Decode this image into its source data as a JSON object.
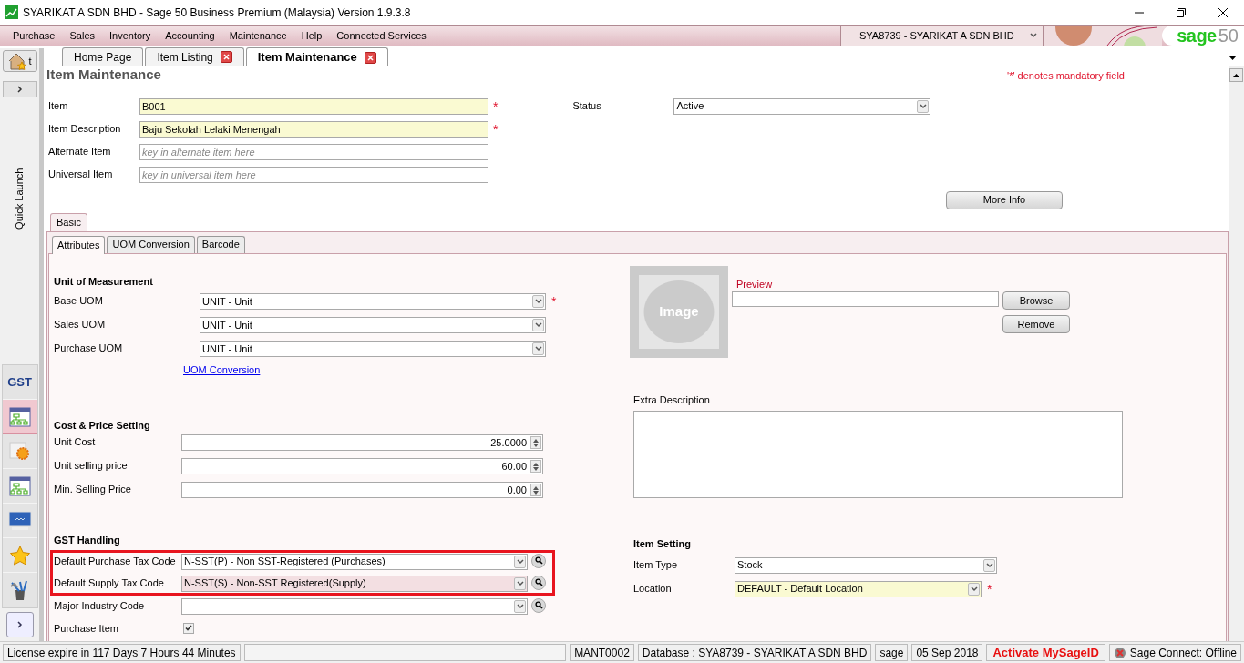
{
  "window": {
    "title": "SYARIKAT A SDN BHD - Sage 50 Business Premium (Malaysia) Version 1.9.3.8"
  },
  "menu": [
    "Purchase",
    "Sales",
    "Inventory",
    "Accounting",
    "Maintenance",
    "Help",
    "Connected Services"
  ],
  "company_selector": {
    "value": "SYA8739 - SYARIKAT A SDN BHD"
  },
  "logo": {
    "brand": "sage",
    "number": "50"
  },
  "sidebar": {
    "home_label": "t",
    "quick_launch": "Quick Launch",
    "items": [
      {
        "kind": "gst",
        "label": "GST",
        "selected": false
      },
      {
        "kind": "tree",
        "selected": true
      },
      {
        "kind": "sun",
        "selected": false
      },
      {
        "kind": "tree",
        "selected": false
      },
      {
        "kind": "monitor",
        "selected": false
      },
      {
        "kind": "star",
        "selected": false
      },
      {
        "kind": "tools",
        "selected": false
      }
    ]
  },
  "tabs": [
    {
      "label": "Home Page",
      "selected": false,
      "closable": false
    },
    {
      "label": "Item Listing",
      "selected": false,
      "closable": true
    },
    {
      "label": "Item Maintenance",
      "selected": true,
      "closable": true
    }
  ],
  "page": {
    "title": "Item Maintenance",
    "mandatory_note": "'*' denotes mandatory field"
  },
  "header_fields": [
    {
      "label": "Item",
      "value": "B001",
      "required_mark": "*",
      "shaded": true
    },
    {
      "label": "Item Description",
      "value": "Baju Sekolah Lelaki Menengah",
      "required_mark": "*",
      "shaded": true
    },
    {
      "label": "Alternate Item",
      "placeholder": "key in alternate item here",
      "shaded": false
    },
    {
      "label": "Universal Item",
      "placeholder": "key in universal item here",
      "shaded": false
    }
  ],
  "status": {
    "label": "Status",
    "value": "Active"
  },
  "more_info": "More Info",
  "section_tabs": [
    {
      "label": "Basic",
      "selected": true
    }
  ],
  "sub_tabs": [
    {
      "label": "Attributes",
      "selected": true
    },
    {
      "label": "UOM Conversion",
      "selected": false
    },
    {
      "label": "Barcode",
      "selected": false
    }
  ],
  "uom": {
    "title": "Unit of Measurement",
    "fields": [
      {
        "label": "Base UOM",
        "value": "UNIT - Unit",
        "required_mark": "*"
      },
      {
        "label": "Sales UOM",
        "value": "UNIT - Unit"
      },
      {
        "label": "Purchase UOM",
        "value": "UNIT - Unit"
      }
    ],
    "link": "UOM Conversion"
  },
  "image": {
    "placeholder_text": "Image",
    "preview_label": "Preview",
    "buttons": [
      "Browse",
      "Remove"
    ]
  },
  "cost_price": {
    "title": "Cost & Price Setting",
    "fields": [
      {
        "label": "Unit Cost",
        "value": "25.0000"
      },
      {
        "label": "Unit selling price",
        "value": "60.00"
      },
      {
        "label": "Min. Selling Price",
        "value": "0.00"
      }
    ]
  },
  "extra_description": {
    "label": "Extra Description"
  },
  "gst": {
    "title": "GST Handling",
    "fields": [
      {
        "label": "Default Purchase Tax Code",
        "value": "N-SST(P) - Non SST-Registered (Purchases)",
        "highlighted": true,
        "focused": false
      },
      {
        "label": "Default Supply Tax Code",
        "value": "N-SST(S) - Non-SST Registered(Supply)",
        "highlighted": true,
        "focused": true
      },
      {
        "label": "Major Industry Code",
        "highlighted": false,
        "focused": false
      }
    ],
    "purchase_item": {
      "label": "Purchase Item",
      "checked": true
    }
  },
  "item_setting": {
    "title": "Item Setting",
    "fields": [
      {
        "label": "Item Type",
        "value": "Stock",
        "shaded": false
      },
      {
        "label": "Location",
        "value": "DEFAULT - Default Location",
        "required_mark": "*",
        "shaded": true
      }
    ]
  },
  "status_bar": [
    {
      "kind": "text",
      "text": "License expire in 117 Days 7 Hours 44 Minutes"
    },
    {
      "kind": "blank"
    },
    {
      "kind": "text",
      "text": "MANT0002"
    },
    {
      "kind": "text",
      "text": "Database : SYA8739 - SYARIKAT A SDN BHD"
    },
    {
      "kind": "text",
      "text": "sage"
    },
    {
      "kind": "text",
      "text": "05 Sep 2018"
    },
    {
      "kind": "alert",
      "text": "Activate MySageID"
    },
    {
      "kind": "offline",
      "text": "Sage Connect: Offline"
    }
  ]
}
